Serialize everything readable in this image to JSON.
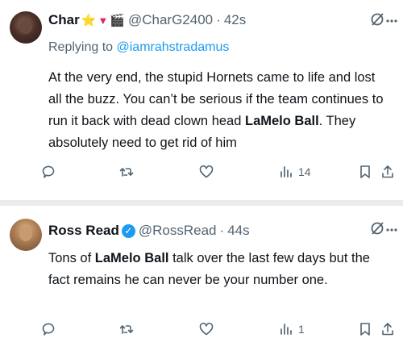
{
  "tweets": [
    {
      "name": "Char",
      "emojis": [
        "⭐",
        "▼",
        "🎬"
      ],
      "handle": "@CharG2400",
      "dot": "·",
      "time": "42s",
      "reply_prefix": "Replying to",
      "reply_to": "@iamrahstradamus",
      "text_parts": [
        "At the very end, the stupid Hornets came to life and lost all the buzz.  You can’t be serious if the team continues to run it back with dead clown head ",
        "LaMelo Ball",
        ".  They absolutely need to get rid of him"
      ],
      "views": "14",
      "icons": [
        "grok-icon",
        "more-icon",
        "reply-icon",
        "retweet-icon",
        "like-icon",
        "views-icon",
        "bookmark-icon",
        "share-icon"
      ]
    },
    {
      "name": "Ross Read",
      "verified": true,
      "handle": "@RossRead",
      "dot": "·",
      "time": "44s",
      "text_parts": [
        "Tons of ",
        "LaMelo Ball",
        " talk over the last few days but the fact remains he can never be your number one."
      ],
      "views": "1",
      "icons": [
        "grok-icon",
        "more-icon",
        "reply-icon",
        "retweet-icon",
        "like-icon",
        "views-icon",
        "bookmark-icon",
        "share-icon"
      ]
    }
  ],
  "colors": {
    "text_primary": "#0f1419",
    "text_secondary": "#536471",
    "link": "#1d9bf0",
    "separator": "#e9ebec"
  }
}
